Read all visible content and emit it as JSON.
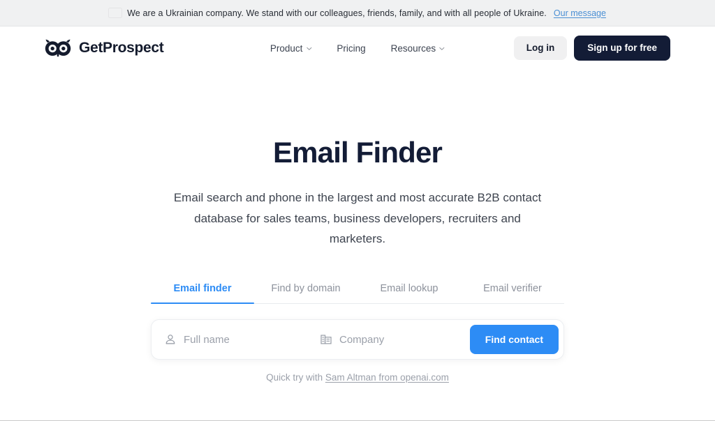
{
  "banner": {
    "flag_icon": "ukraine-flag-icon",
    "text": "We are a Ukrainian company. We stand with our colleagues, friends, family, and with all people of Ukraine.",
    "link_label": "Our message"
  },
  "header": {
    "logo_icon": "owl-logo-icon",
    "brand_name": "GetProspect",
    "nav": [
      {
        "label": "Product",
        "has_chevron": true,
        "chevron_icon": "chevron-down-icon"
      },
      {
        "label": "Pricing",
        "has_chevron": false
      },
      {
        "label": "Resources",
        "has_chevron": true,
        "chevron_icon": "chevron-down-icon"
      }
    ],
    "login_label": "Log in",
    "signup_label": "Sign up for free"
  },
  "hero": {
    "title": "Email Finder",
    "subtitle": "Email search and phone in the largest and most accurate B2B contact database for sales teams, business developers, recruiters and marketers."
  },
  "tool": {
    "tabs": [
      {
        "label": "Email finder",
        "active": true
      },
      {
        "label": "Find by domain",
        "active": false
      },
      {
        "label": "Email lookup",
        "active": false
      },
      {
        "label": "Email verifier",
        "active": false
      }
    ],
    "form": {
      "name_icon": "person-icon",
      "name_placeholder": "Full name",
      "name_value": "",
      "company_icon": "building-icon",
      "company_placeholder": "Company",
      "company_value": "",
      "submit_label": "Find contact"
    },
    "quick_try": {
      "prefix": "Quick try with ",
      "link_label": "Sam Altman from openai.com"
    }
  },
  "colors": {
    "accent_blue": "#2d8cf5",
    "dark_navy": "#131c36",
    "banner_bg": "#f0f1f2",
    "muted_text": "#9ba0aa",
    "flag_blue": "#3b7bd4",
    "flag_yellow": "#f5c845"
  }
}
